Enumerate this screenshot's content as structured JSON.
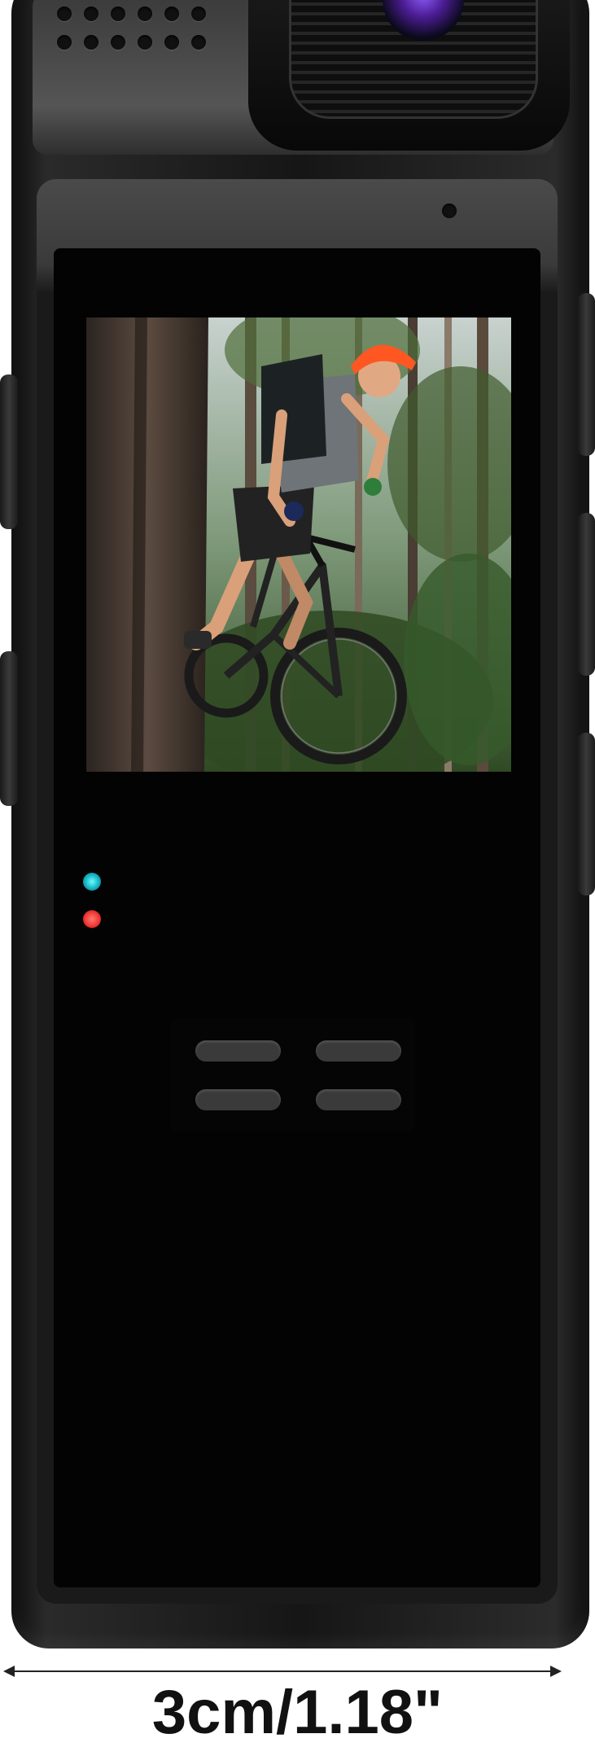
{
  "product": {
    "measurement": {
      "label": "3cm/1.18\"",
      "color": "#111111"
    },
    "leds": [
      {
        "name": "status-led-cyan",
        "color": "#1ab3bf"
      },
      {
        "name": "status-led-red",
        "color": "#e33333"
      }
    ],
    "screen_content": "cyclist-riding-mountain-bike-in-forest",
    "camera_lens_color": "#7c3aed"
  }
}
